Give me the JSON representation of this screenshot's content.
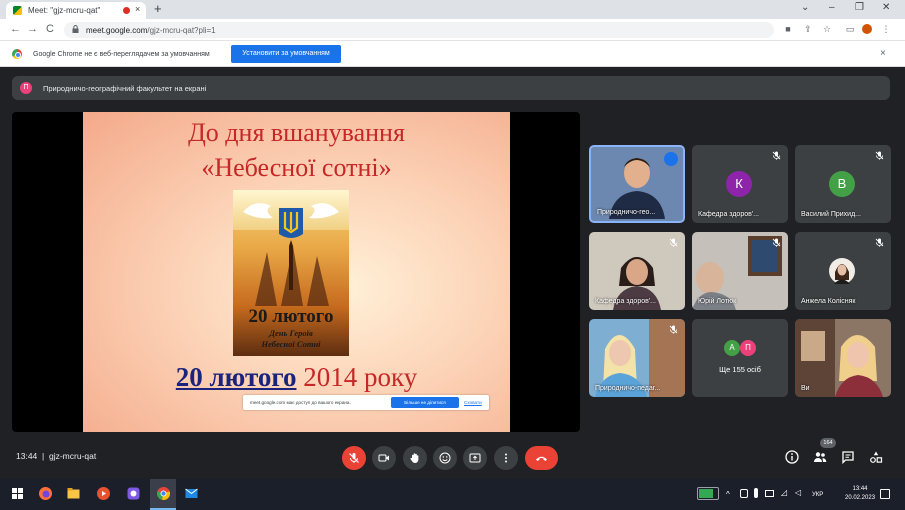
{
  "browser": {
    "tab_title": "Meet: \"gjz-mcru-qat\"",
    "tab_close": "×",
    "new_tab": "+",
    "win_minimize": "⌄",
    "win_min": "–",
    "win_max": "❐",
    "win_close": "✕",
    "back": "←",
    "forward": "→",
    "reload": "C",
    "url_host": "meet.google.com",
    "url_path": "/gjz-mcru-qat?pli=1"
  },
  "infobar": {
    "message": "Google Chrome не є веб-переглядачем за умовчанням",
    "button_label": "Установити за умовчанням",
    "close": "×"
  },
  "presentation_banner": {
    "avatar_letter": "П",
    "text": "Природничо-географічний факультет на екрані"
  },
  "slide": {
    "title_line1": "До дня вшанування",
    "title_line2": "«Небесної сотні»",
    "poster_big": "20 лютого",
    "poster_small_line1": "День Героїв",
    "poster_small_line2": "Небесної Сотні",
    "date_part1": "20 лютого",
    "date_part2": " 2014 року"
  },
  "share_notice": {
    "message": "meet.google.com має доступ до вашого екрана.",
    "stop_button": "Більше не ділитися",
    "hide_link": "Сховати"
  },
  "participants": [
    {
      "name": "Природничо-гео...",
      "avatar": "",
      "color": "#5b7aa8",
      "speaking": true
    },
    {
      "name": "Кафедра здоров'...",
      "avatar": "К",
      "color": "#8e24aa",
      "speaking": false
    },
    {
      "name": "Василий Прихид...",
      "avatar": "В",
      "color": "#43a047",
      "speaking": false
    },
    {
      "name": "Кафедра здоров'...",
      "avatar": "",
      "color": "#c9c2b8",
      "speaking": false
    },
    {
      "name": "Юрій Лотюк",
      "avatar": "",
      "color": "#b7b2ad",
      "speaking": false
    },
    {
      "name": "Анжела Колісняк",
      "avatar": "",
      "color": "#3c4043",
      "speaking": false
    },
    {
      "name": "Природничо-педаг...",
      "avatar": "",
      "color": "#6fa9d6",
      "speaking": false
    },
    {
      "name": "Ще 155 осіб",
      "avatar": "",
      "color": "#3c4043",
      "speaking": false
    },
    {
      "name": "Ви",
      "avatar": "",
      "color": "#8d7a6a",
      "speaking": false
    }
  ],
  "more_avatars": [
    "А",
    "П"
  ],
  "bottom": {
    "time": "13:44",
    "separator": "|",
    "meeting_code": "gjz-mcru-qat",
    "participant_count": "164"
  },
  "taskbar": {
    "lang": "УКР",
    "clock_time": "13:44",
    "clock_date": "20.02.2023"
  }
}
